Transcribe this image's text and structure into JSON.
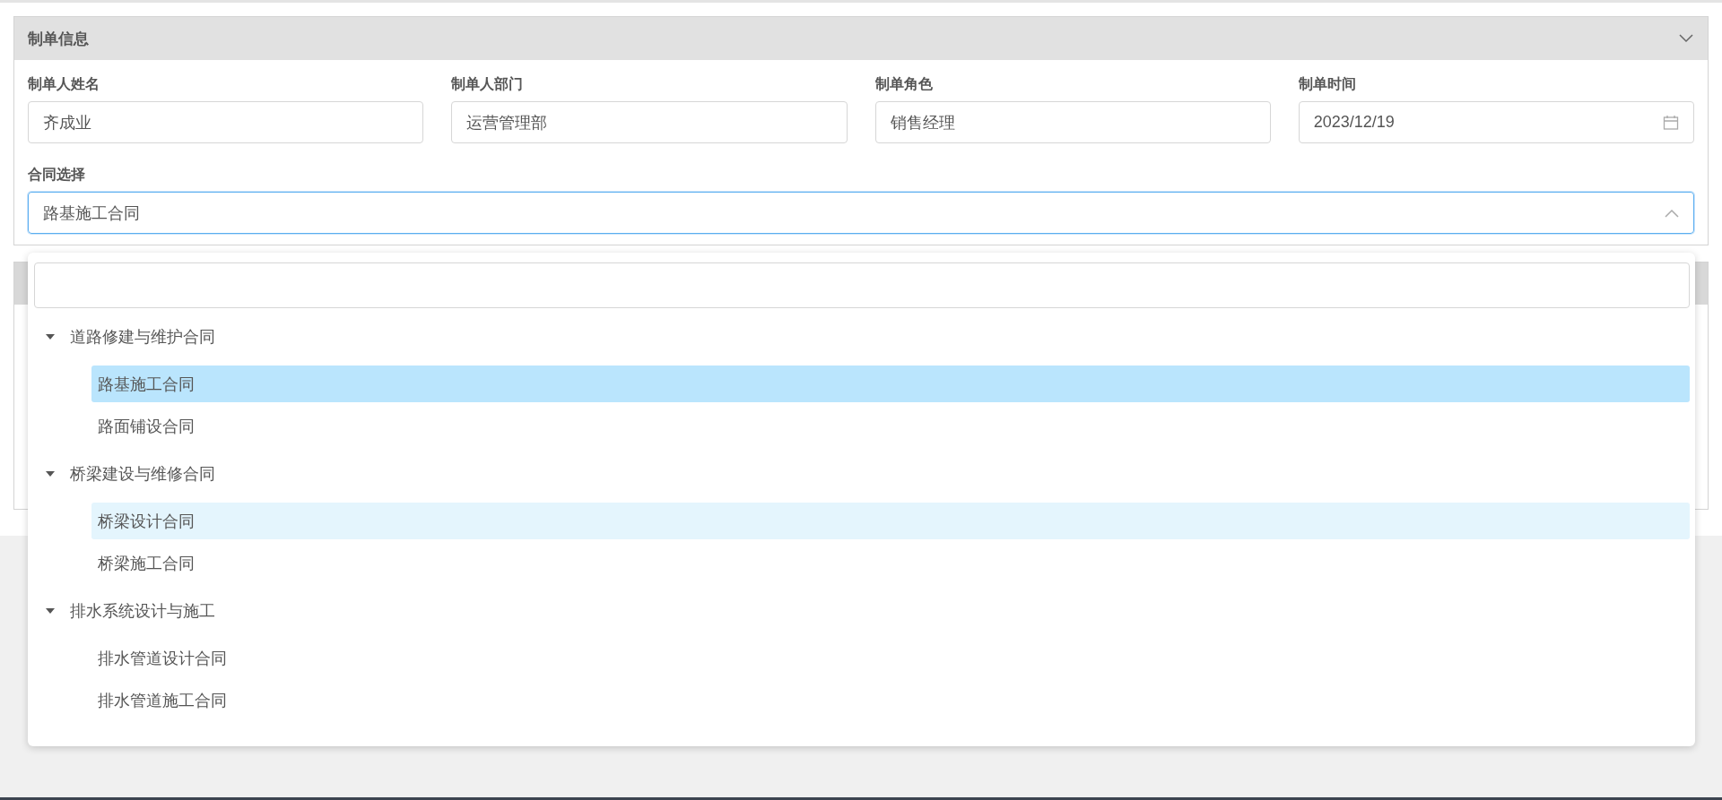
{
  "panel": {
    "title": "制单信息",
    "expanded": true
  },
  "fields": [
    {
      "label": "制单人姓名",
      "value": "齐成业",
      "kind": "text"
    },
    {
      "label": "制单人部门",
      "value": "运营管理部",
      "kind": "text"
    },
    {
      "label": "制单角色",
      "value": "销售经理",
      "kind": "text"
    },
    {
      "label": "制单时间",
      "value": "2023/12/19",
      "kind": "date"
    }
  ],
  "contract_select": {
    "label": "合同选择",
    "value": "路基施工合同",
    "expanded": true
  },
  "tree": [
    {
      "label": "道路修建与维护合同",
      "expanded": true,
      "children": [
        {
          "label": "路基施工合同",
          "selected": true,
          "hovered": false
        },
        {
          "label": "路面铺设合同",
          "selected": false,
          "hovered": false
        }
      ]
    },
    {
      "label": "桥梁建设与维修合同",
      "expanded": true,
      "children": [
        {
          "label": "桥梁设计合同",
          "selected": false,
          "hovered": true
        },
        {
          "label": "桥梁施工合同",
          "selected": false,
          "hovered": false
        }
      ]
    },
    {
      "label": "排水系统设计与施工",
      "expanded": true,
      "children": [
        {
          "label": "排水管道设计合同",
          "selected": false,
          "hovered": false
        },
        {
          "label": "排水管道施工合同",
          "selected": false,
          "hovered": false
        }
      ]
    }
  ]
}
